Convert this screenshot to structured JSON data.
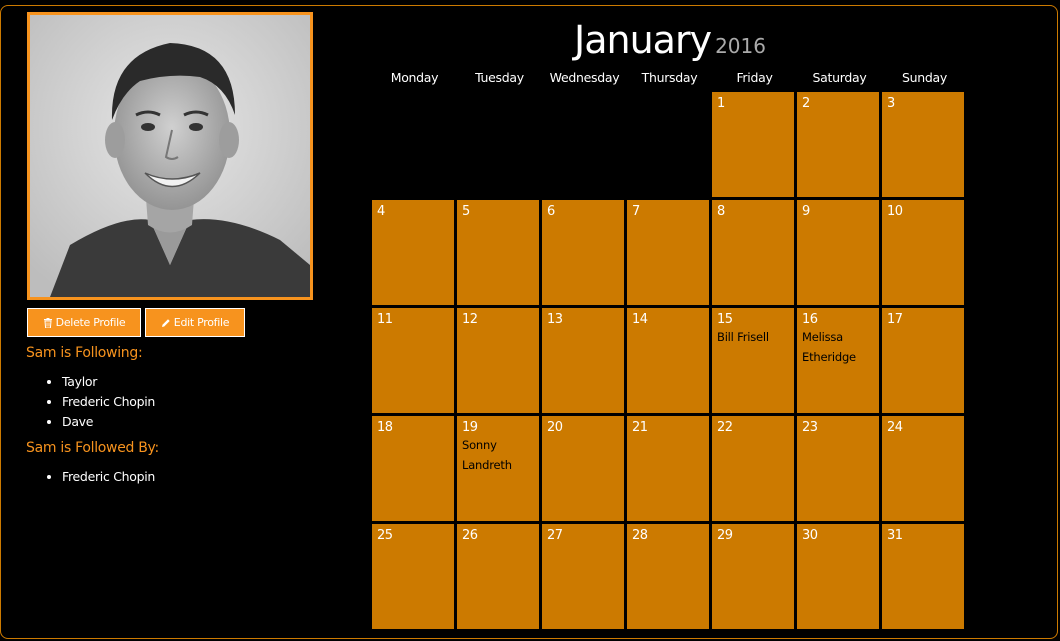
{
  "profile": {
    "delete_label": "Delete Profile",
    "edit_label": "Edit Profile",
    "following_heading": "Sam is Following:",
    "following": [
      "Taylor",
      "Frederic Chopin",
      "Dave"
    ],
    "followed_heading": "Sam is Followed By:",
    "followed_by": [
      "Frederic Chopin"
    ]
  },
  "calendar": {
    "month": "January",
    "year": "2016",
    "weekdays": [
      "Monday",
      "Tuesday",
      "Wednesday",
      "Thursday",
      "Friday",
      "Saturday",
      "Sunday"
    ],
    "leading_blanks": 4,
    "days": [
      {
        "day": "1",
        "event": ""
      },
      {
        "day": "2",
        "event": ""
      },
      {
        "day": "3",
        "event": ""
      },
      {
        "day": "4",
        "event": ""
      },
      {
        "day": "5",
        "event": ""
      },
      {
        "day": "6",
        "event": ""
      },
      {
        "day": "7",
        "event": ""
      },
      {
        "day": "8",
        "event": ""
      },
      {
        "day": "9",
        "event": ""
      },
      {
        "day": "10",
        "event": ""
      },
      {
        "day": "11",
        "event": ""
      },
      {
        "day": "12",
        "event": ""
      },
      {
        "day": "13",
        "event": ""
      },
      {
        "day": "14",
        "event": ""
      },
      {
        "day": "15",
        "event": "Bill Frisell"
      },
      {
        "day": "16",
        "event": "Melissa Etheridge"
      },
      {
        "day": "17",
        "event": ""
      },
      {
        "day": "18",
        "event": ""
      },
      {
        "day": "19",
        "event": "Sonny Landreth"
      },
      {
        "day": "20",
        "event": ""
      },
      {
        "day": "21",
        "event": ""
      },
      {
        "day": "22",
        "event": ""
      },
      {
        "day": "23",
        "event": ""
      },
      {
        "day": "24",
        "event": ""
      },
      {
        "day": "25",
        "event": ""
      },
      {
        "day": "26",
        "event": ""
      },
      {
        "day": "27",
        "event": ""
      },
      {
        "day": "28",
        "event": ""
      },
      {
        "day": "29",
        "event": ""
      },
      {
        "day": "30",
        "event": ""
      },
      {
        "day": "31",
        "event": ""
      }
    ]
  },
  "colors": {
    "accent": "#f7931e",
    "cell": "#cc7a00",
    "background": "#000000"
  },
  "icons": {
    "delete": "trash-icon",
    "edit": "pencil-icon"
  }
}
